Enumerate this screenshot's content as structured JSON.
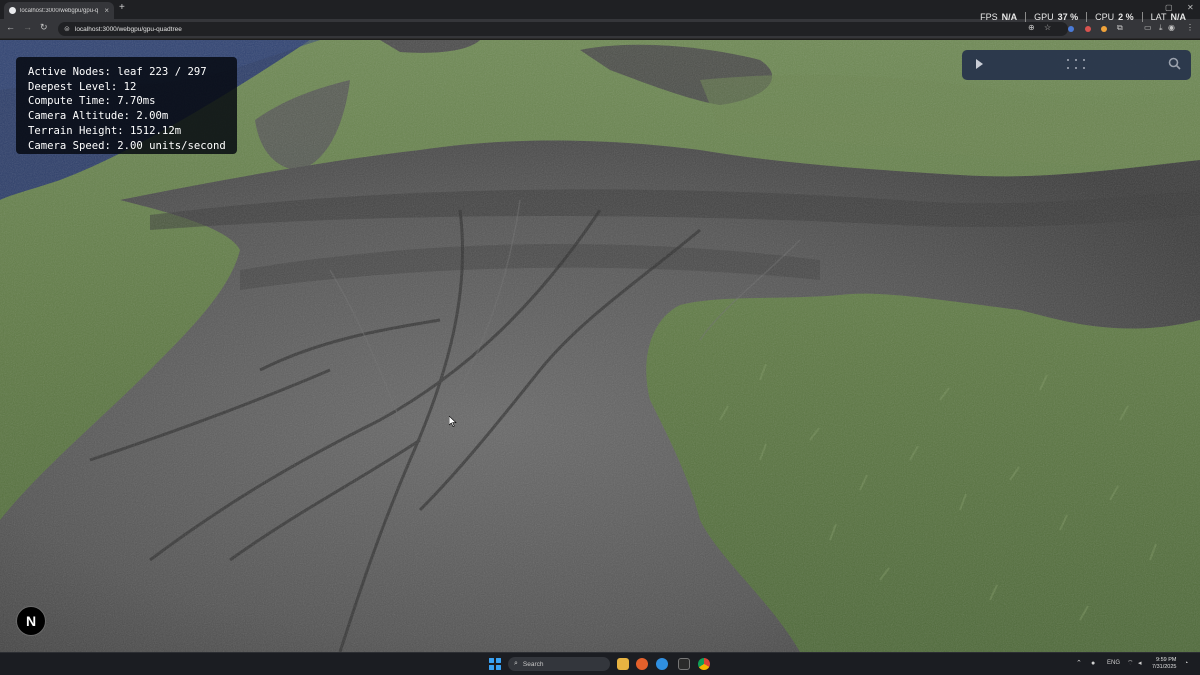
{
  "browser": {
    "tab": {
      "title": "localhost:3000/webgpu/gpu-q",
      "close_icon": "×"
    },
    "new_tab_icon": "+",
    "url": "localhost:3000/webgpu/gpu-quadtree",
    "window_controls": {
      "minimize": "–",
      "maximize": "▢",
      "close": "✕"
    }
  },
  "perf_overlay": {
    "items": [
      {
        "label": "FPS",
        "value": "N/A"
      },
      {
        "label": "GPU",
        "value": "37 %"
      },
      {
        "label": "CPU",
        "value": "2 %"
      },
      {
        "label": "LAT",
        "value": "N/A"
      }
    ]
  },
  "stats": {
    "lines": [
      "Active Nodes: leaf 223 / 297",
      "Deepest Level: 12",
      "Compute Time: 7.70ms",
      "Camera Altitude: 2.00m",
      "Terrain Height: 1512.12m",
      "Camera Speed: 2.00 units/second"
    ]
  },
  "badge": {
    "letter": "N"
  },
  "taskbar": {
    "search_placeholder": "Search",
    "tray": {
      "language": "ENG",
      "time": "9:59 PM",
      "date": "7/31/2025"
    }
  },
  "colors": {
    "grass": "#5f7a45",
    "rock": "#4f4f4f",
    "water": "#2e3f6a",
    "accent_blue": "#3aa3f5"
  }
}
